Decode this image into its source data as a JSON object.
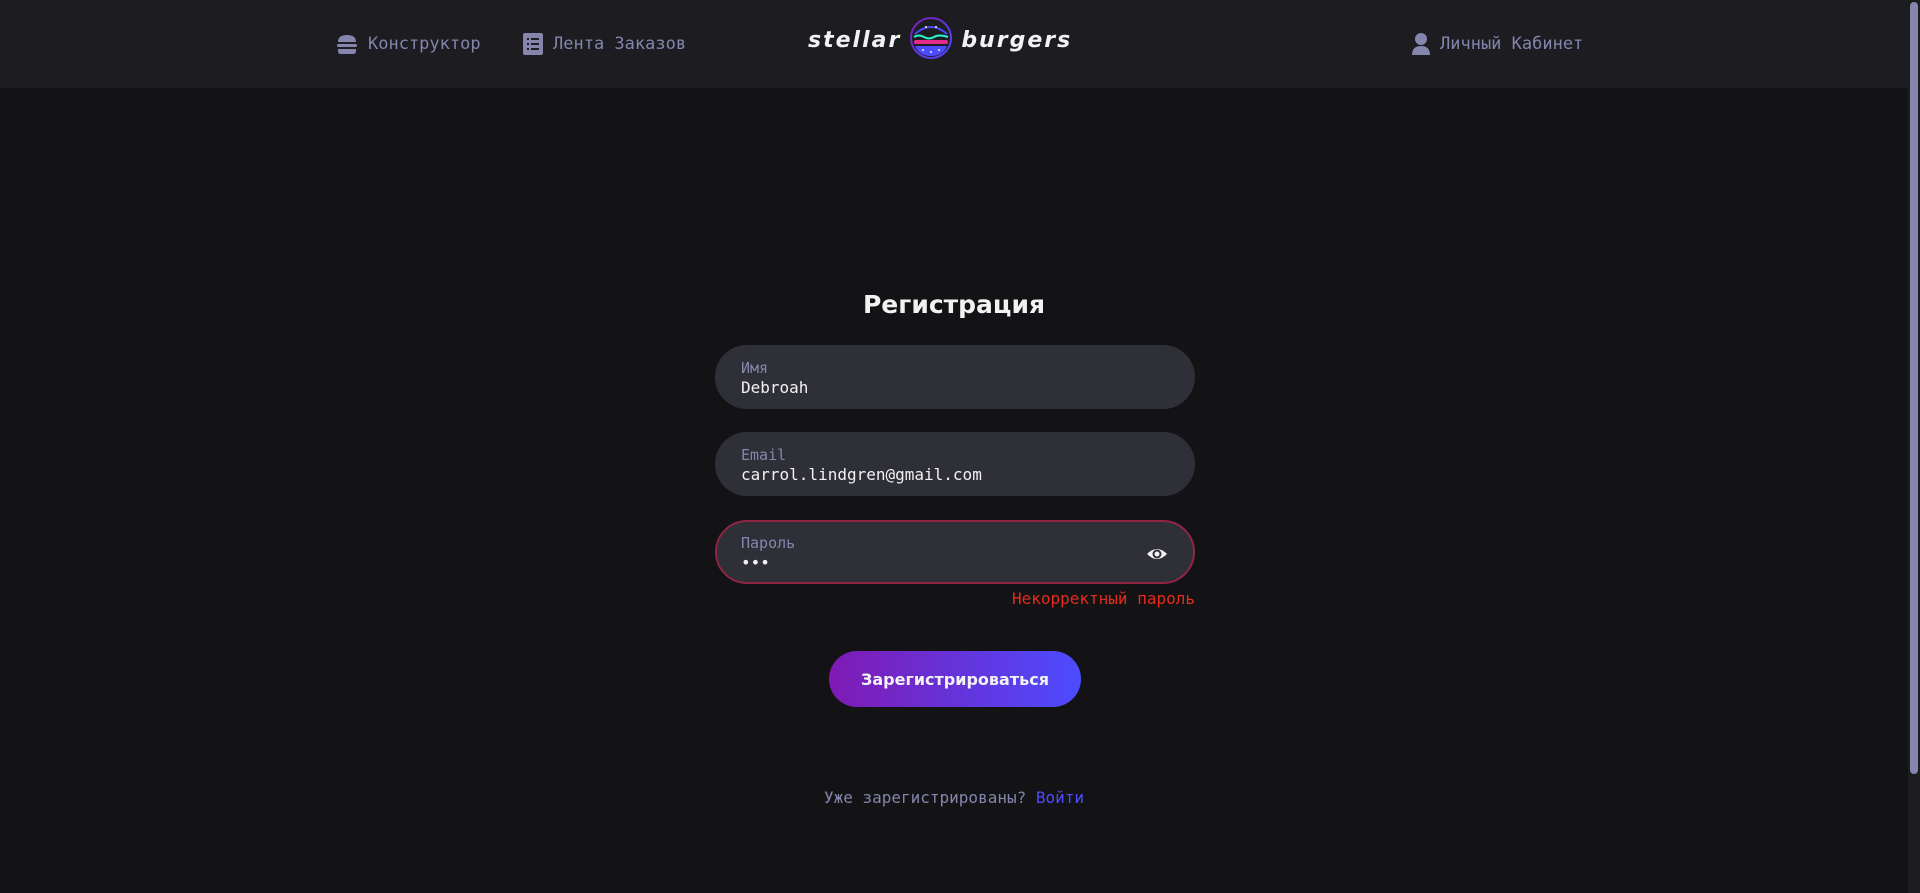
{
  "header": {
    "nav": {
      "constructor_label": "Конструктор",
      "feed_label": "Лента Заказов",
      "profile_label": "Личный Кабинет"
    },
    "logo": {
      "left_word": "stellar",
      "right_word": "burgers"
    }
  },
  "form": {
    "title": "Регистрация",
    "name": {
      "label": "Имя",
      "value": "Debroah"
    },
    "email": {
      "label": "Email",
      "value": "carrol.lindgren@gmail.com"
    },
    "password": {
      "label": "Пароль",
      "value": "•••",
      "error": "Некорректный пароль"
    },
    "submit_label": "Зарегистрироваться",
    "already_registered": "Уже зарегистрированы?",
    "login_link": "Войти"
  },
  "colors": {
    "background": "#131316",
    "header": "#1C1C21",
    "input": "#2F2F37",
    "muted": "#8585AD",
    "accent": "#4C4CFF",
    "error": "#E52B1A"
  },
  "icons": [
    "burger-icon",
    "list-icon",
    "profile-icon",
    "eye-icon"
  ]
}
